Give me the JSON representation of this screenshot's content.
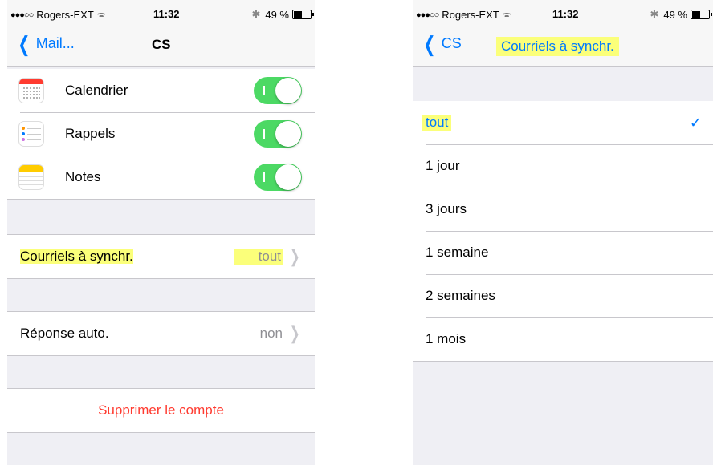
{
  "left": {
    "status": {
      "dots": "●●●○○",
      "carrier": "Rogers-EXT",
      "wifi": "ᯤ",
      "time": "11:32",
      "bluetooth": "✱",
      "battery": "49 %",
      "battery_level": 0.49
    },
    "nav": {
      "back": "Mail...",
      "title": "CS"
    },
    "apps": [
      {
        "icon": "calendar-icon",
        "label": "Calendrier",
        "enabled": true
      },
      {
        "icon": "reminders-icon",
        "label": "Rappels",
        "enabled": true
      },
      {
        "icon": "notes-icon",
        "label": "Notes",
        "enabled": true
      }
    ],
    "mail_sync": {
      "label": "Courriels à synchr.",
      "value": "tout"
    },
    "auto_reply": {
      "label": "Réponse auto.",
      "value": "non"
    },
    "delete_account": "Supprimer le compte",
    "highlight_color": "#fbff7a",
    "toggle_color": "#4cd964",
    "destructive_color": "#ff3b30"
  },
  "right": {
    "status": {
      "dots": "●●●○○",
      "carrier": "Rogers-EXT",
      "wifi": "ᯤ",
      "time": "11:32",
      "bluetooth": "✱",
      "battery": "49 %",
      "battery_level": 0.49
    },
    "nav": {
      "back": "CS",
      "title": "Courriels à synchr."
    },
    "options": [
      {
        "label": "tout",
        "selected": true
      },
      {
        "label": "1 jour",
        "selected": false
      },
      {
        "label": "3 jours",
        "selected": false
      },
      {
        "label": "1 semaine",
        "selected": false
      },
      {
        "label": "2 semaines",
        "selected": false
      },
      {
        "label": "1 mois",
        "selected": false
      }
    ],
    "checkmark": "✓",
    "accent_color": "#007aff"
  }
}
